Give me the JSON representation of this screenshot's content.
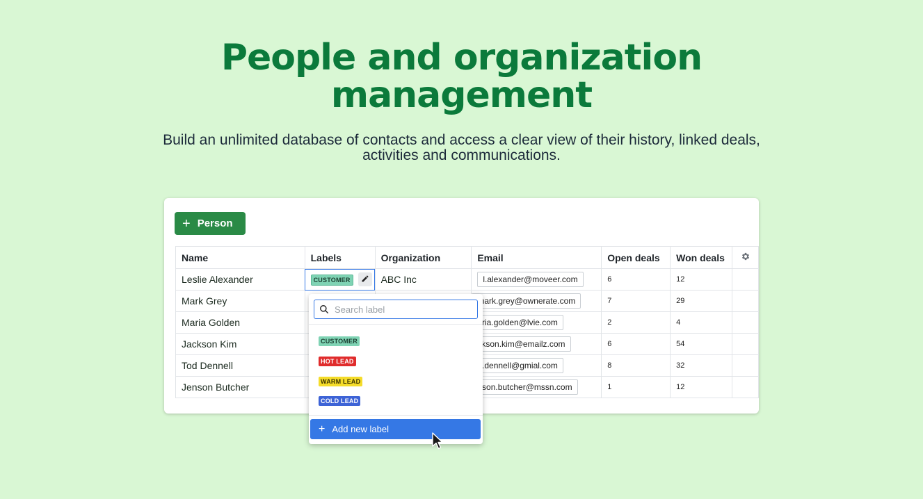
{
  "hero": {
    "title_line1": "People and organization",
    "title_line2": "management",
    "subtitle": "Build an unlimited database of contacts and access a clear view of their history, linked deals, activities and communications."
  },
  "toolbar": {
    "add_person_label": "Person"
  },
  "table": {
    "headers": {
      "name": "Name",
      "labels": "Labels",
      "organization": "Organization",
      "email": "Email",
      "open_deals": "Open deals",
      "won_deals": "Won deals"
    },
    "rows": [
      {
        "name": "Leslie Alexander",
        "label": "CUSTOMER",
        "organization": "ABC Inc",
        "email": "l.alexander@moveer.com",
        "open_deals": "6",
        "won_deals": "12"
      },
      {
        "name": "Mark Grey",
        "label": "",
        "organization": "",
        "email": "mark.grey@ownerate.com",
        "open_deals": "7",
        "won_deals": "29"
      },
      {
        "name": "Maria Golden",
        "label": "",
        "organization": "",
        "email": "aria.golden@lvie.com",
        "open_deals": "2",
        "won_deals": "4"
      },
      {
        "name": "Jackson Kim",
        "label": "",
        "organization": "",
        "email": "ckson.kim@emailz.com",
        "open_deals": "6",
        "won_deals": "54"
      },
      {
        "name": "Tod Dennell",
        "label": "",
        "organization": "",
        "email": "d.dennell@gmial.com",
        "open_deals": "8",
        "won_deals": "32"
      },
      {
        "name": "Jenson Butcher",
        "label": "",
        "organization": "",
        "email": "nson.butcher@mssn.com",
        "open_deals": "1",
        "won_deals": "12"
      }
    ]
  },
  "dropdown": {
    "search_placeholder": "Search label",
    "options": [
      {
        "label": "CUSTOMER",
        "bg": "#7fd3b4",
        "fg": "#1a3d30"
      },
      {
        "label": "HOT LEAD",
        "bg": "#e02c2c",
        "fg": "#ffffff"
      },
      {
        "label": "WARM LEAD",
        "bg": "#f5dc2a",
        "fg": "#3a3200"
      },
      {
        "label": "COLD LEAD",
        "bg": "#3d63d6",
        "fg": "#ffffff"
      }
    ],
    "add_new_label": "Add new label"
  },
  "colors": {
    "background": "#d9f7d4",
    "title": "#0b7a3b",
    "primary_button": "#2a8a46",
    "accent_blue": "#3578e5"
  },
  "icons": {
    "add": "plus-icon",
    "edit": "pencil-icon",
    "settings": "gear-icon",
    "search": "search-icon",
    "pointer": "cursor-icon"
  }
}
